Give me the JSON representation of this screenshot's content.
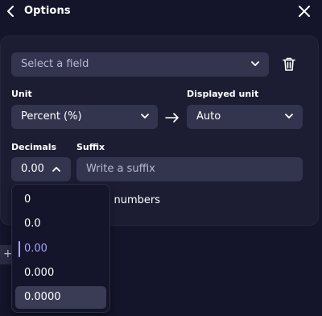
{
  "header": {
    "title": "Options"
  },
  "field_select": {
    "placeholder": "Select a field"
  },
  "unit": {
    "label": "Unit",
    "value": "Percent (%)"
  },
  "displayed_unit": {
    "label": "Displayed unit",
    "value": "Auto"
  },
  "decimals": {
    "label": "Decimals",
    "value": "0.00",
    "options": [
      "0",
      "0.0",
      "0.00",
      "0.000",
      "0.0000"
    ],
    "selected": "0.00",
    "hovered": "0.0000"
  },
  "suffix": {
    "label": "Suffix",
    "placeholder": "Write a suffix"
  },
  "large_numbers": {
    "partial_label": "rge numbers"
  },
  "colors": {
    "accent": "#a8a6ff",
    "panel": "#1c1d33",
    "control": "#33354f"
  }
}
